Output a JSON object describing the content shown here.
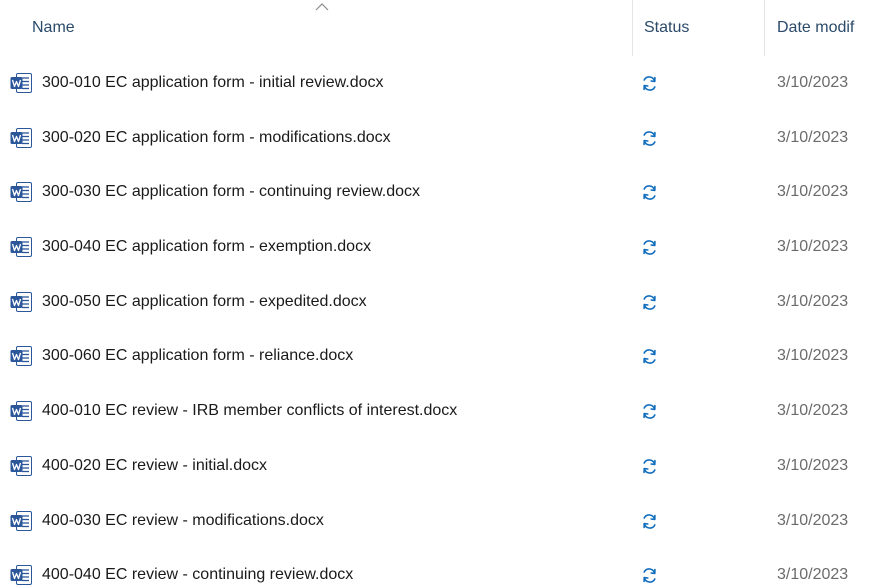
{
  "columns": {
    "name": "Name",
    "status": "Status",
    "date": "Date modif"
  },
  "sort": {
    "column": "name",
    "direction": "ascending"
  },
  "colors": {
    "header_text": "#2b4a6a",
    "word_blue": "#2b579a",
    "sync_blue": "#0f6cbd",
    "date_text": "#6b6b6b"
  },
  "files": [
    {
      "name": "300-010 EC application form - initial review.docx",
      "status_icon": "sync-pending-icon",
      "date": "3/10/2023"
    },
    {
      "name": "300-020 EC application form - modifications.docx",
      "status_icon": "sync-pending-icon",
      "date": "3/10/2023"
    },
    {
      "name": "300-030 EC application form - continuing review.docx",
      "status_icon": "sync-pending-icon",
      "date": "3/10/2023"
    },
    {
      "name": "300-040 EC application form - exemption.docx",
      "status_icon": "sync-pending-icon",
      "date": "3/10/2023"
    },
    {
      "name": "300-050 EC application form - expedited.docx",
      "status_icon": "sync-pending-icon",
      "date": "3/10/2023"
    },
    {
      "name": "300-060 EC application form - reliance.docx",
      "status_icon": "sync-pending-icon",
      "date": "3/10/2023"
    },
    {
      "name": "400-010 EC review - IRB member conflicts of interest.docx",
      "status_icon": "sync-pending-icon",
      "date": "3/10/2023"
    },
    {
      "name": "400-020 EC review - initial.docx",
      "status_icon": "sync-pending-icon",
      "date": "3/10/2023"
    },
    {
      "name": "400-030 EC review - modifications.docx",
      "status_icon": "sync-pending-icon",
      "date": "3/10/2023"
    },
    {
      "name": "400-040 EC review - continuing review.docx",
      "status_icon": "sync-pending-icon",
      "date": "3/10/2023"
    }
  ]
}
